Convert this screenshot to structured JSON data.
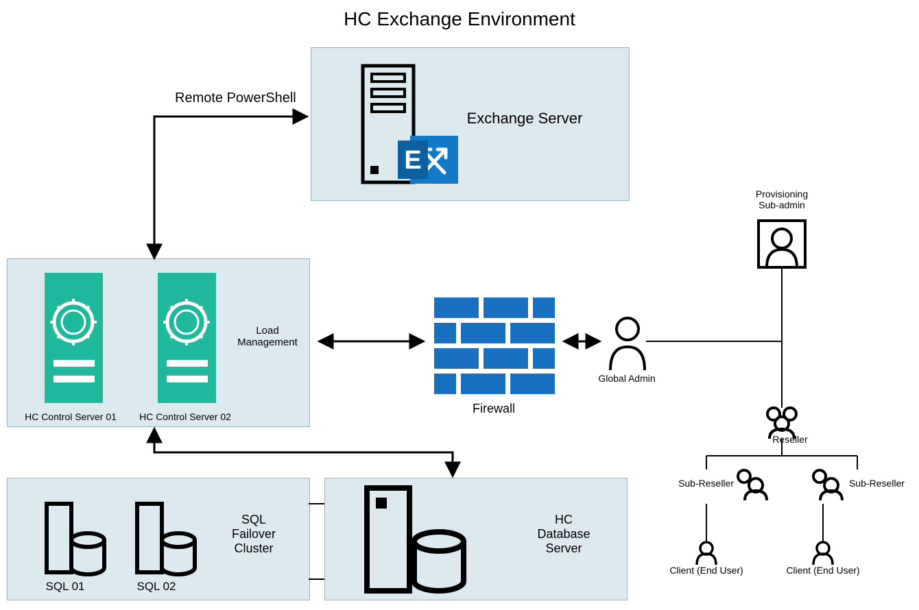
{
  "title": "HC Exchange Environment",
  "labels": {
    "remote_powershell": "Remote PowerShell",
    "exchange_server": "Exchange Server",
    "load_management": "Load\nManagement",
    "firewall": "Firewall",
    "global_admin": "Global Admin",
    "hc_control_01": "HC Control Server 01",
    "hc_control_02": "HC Control Server 02",
    "sql_failover": "SQL\nFailover\nCluster",
    "sql01": "SQL 01",
    "sql02": "SQL 02",
    "hc_db_server": "HC\nDatabase\nServer",
    "provisioning": "Provisioning\nSub-admin",
    "reseller": "Reseller",
    "sub_reseller_l": "Sub-Reseller",
    "sub_reseller_r": "Sub-Reseller",
    "client_l": "Client (End User)",
    "client_r": "Client (End User)"
  },
  "colors": {
    "panel_bg": "#dce9ef",
    "panel_border": "#8fb4c4",
    "teal": "#1fb89b",
    "exchange_blue": "#1179c7",
    "firewall_blue": "#1a70c0"
  }
}
